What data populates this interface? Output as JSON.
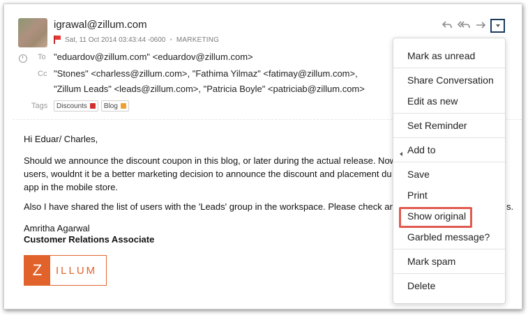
{
  "email": {
    "sender": "igrawal@zillum.com",
    "date": "Sat, 11 Oct 2014 03:43:44 -0600",
    "folder": "MARKETING",
    "to_label": "To",
    "to": "\"eduardov@zillum.com\" <eduardov@zillum.com>",
    "cc_label": "Cc",
    "cc_line1": "\"Stones\" <charless@zillum.com>, \"Fathima Yilmaz\" <fatimay@zillum.com>,",
    "cc_line2": "\"Zillum Leads\" <leads@zillum.com>, \"Patricia Boyle\" <patriciab@zillum.com>",
    "tags_label": "Tags",
    "tags": [
      {
        "label": "Discounts",
        "color": "#d32f2f"
      },
      {
        "label": "Blog",
        "color": "#f0a030"
      }
    ],
    "greeting": "Hi Eduar/ Charles,",
    "para1_line1": "Should we announce the discount coupon in this blog, or later during the actual release. Now",
    "para1_line2": "users, wouldnt it be a better marketing decision to announce the discount and placement du",
    "para1_line3": "app in the mobile store.",
    "para2": "Also I have shared the list of users with the 'Leads' group in the workspace. Please check and",
    "para2_tail": "s.",
    "signature_name": "Amritha Agarwal",
    "signature_title": "Customer Relations Associate",
    "logo_letter": "Z",
    "logo_rest": "ILLUM"
  },
  "menu": {
    "items": [
      "Mark as unread",
      "Share Conversation",
      "Edit as new",
      "Set Reminder",
      "Add to",
      "Save",
      "Print",
      "Show original",
      "Garbled message?",
      "Mark spam",
      "Delete"
    ]
  },
  "colors": {
    "highlight": "#e05a4f",
    "more_button_border": "#1b3a5e",
    "logo_orange": "#e2622b"
  }
}
